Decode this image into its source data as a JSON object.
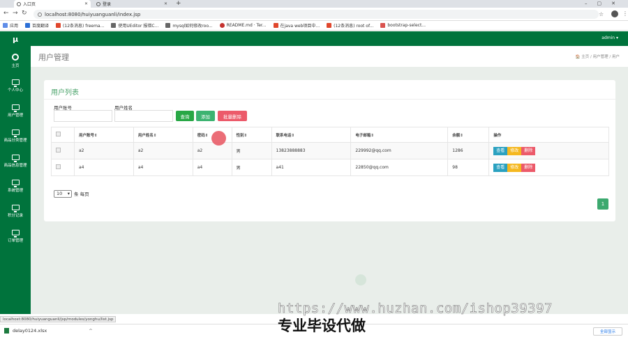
{
  "browser": {
    "tabs": [
      {
        "title": "入口页"
      },
      {
        "title": "登录"
      }
    ],
    "url": "localhost:8080/huiyuanguanli/index.jsp",
    "bookmarks": [
      "应用",
      "百度翻译",
      "(12条消息) freema...",
      "使用UEditor 报错C...",
      "mysql如何修改roo...",
      "README.md · Ter...",
      "在java web项目中...",
      "(12条消息) root of...",
      "bootstrap-select..."
    ]
  },
  "app": {
    "logo": "μ",
    "user_menu": "admin ▾",
    "sidebar": [
      {
        "label": "主页",
        "icon": "dashboard-icon"
      },
      {
        "label": "个人中心",
        "icon": "monitor-icon"
      },
      {
        "label": "用户管理",
        "icon": "monitor-icon"
      },
      {
        "label": "商品分类管理",
        "icon": "monitor-icon"
      },
      {
        "label": "商品信息管理",
        "icon": "monitor-icon"
      },
      {
        "label": "系统管理",
        "icon": "monitor-icon"
      },
      {
        "label": "积分记录",
        "icon": "monitor-icon"
      },
      {
        "label": "订单管理",
        "icon": "monitor-icon"
      }
    ],
    "page_title": "用户管理",
    "breadcrumb": "🏠 主页 / 用户管理 / 用户",
    "card_title": "用户列表",
    "search": {
      "account_label": "用户账号",
      "name_label": "用户姓名",
      "query_button": "查询",
      "add_button": "添加",
      "batch_delete_button": "批量删除"
    },
    "table": {
      "headers": [
        "用户账号⇕",
        "用户姓名⇕",
        "密码⇕",
        "性别⇕",
        "联系电话⇕",
        "电子邮箱⇕",
        "余额⇕",
        "操作"
      ],
      "rows": [
        {
          "account": "a2",
          "name": "a2",
          "password": "a2",
          "gender": "男",
          "phone": "13823888883",
          "email": "229992@qq.com",
          "balance": "1286"
        },
        {
          "account": "a4",
          "name": "a4",
          "password": "a4",
          "gender": "男",
          "phone": "a41",
          "email": "22850@qq.com",
          "balance": "98"
        }
      ],
      "actions": {
        "view": "查看",
        "edit": "修改",
        "delete": "删除"
      }
    },
    "page_size": "10",
    "per_page_label": "条 每页",
    "current_page": "1"
  },
  "status_url": "localhost:8080/huiyuanguanli/jsp/modules/yonghu/list.jsp",
  "download": {
    "file": "delay0124.xlsx",
    "show_all": "全部显示"
  },
  "watermark": {
    "url": "https://www.huzhan.com/ishop39397",
    "text": "专业毕设代做"
  },
  "colors": {
    "brand_green": "#00733c",
    "btn_query": "#28a745",
    "btn_add": "#3cb371",
    "btn_delete": "#ec5a6a",
    "act_view": "#2aa1c0",
    "act_edit": "#f5b820",
    "act_delete": "#ec5a6a"
  }
}
